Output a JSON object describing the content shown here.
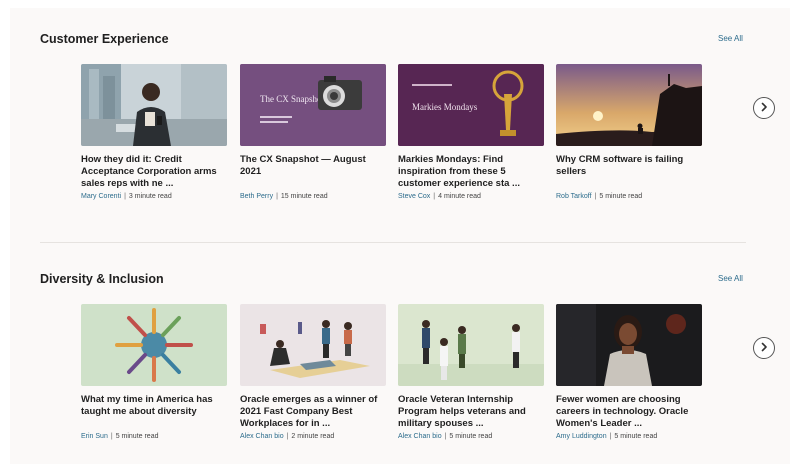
{
  "sections": [
    {
      "title": "Customer Experience",
      "see_all": "See All",
      "cards": [
        {
          "title": "How they did it: Credit Acceptance Corporation arms sales reps with ne ...",
          "author": "Mary Corenti",
          "read": "3 minute read",
          "image": "man-with-phone-city"
        },
        {
          "title": "The CX Snapshot — August 2021",
          "author": "Beth Perry",
          "read": "15 minute read",
          "image": "cx-snapshot-camera"
        },
        {
          "title": "Markies Mondays: Find inspiration from these 5 customer experience sta ...",
          "author": "Steve Cox",
          "read": "4 minute read",
          "image": "markies-trophy"
        },
        {
          "title": "Why CRM software is failing sellers",
          "author": "Rob Tarkoff",
          "read": "5 minute read",
          "image": "sunset-cliff"
        }
      ],
      "thumb_text": {
        "snapshot": "The CX Snapshot",
        "markies": "Markies Mondays"
      }
    },
    {
      "title": "Diversity & Inclusion",
      "see_all": "See All",
      "cards": [
        {
          "title": "What my time in America has taught me about diversity",
          "author": "Erin Sun",
          "read": "5 minute read",
          "image": "pencils-circle-illustration"
        },
        {
          "title": "Oracle emerges as a winner of 2021 Fast Company Best Workplaces for in ...",
          "author": "Alex Chan bio",
          "read": "2 minute read",
          "image": "people-book-illustration"
        },
        {
          "title": "Oracle Veteran Internship Program helps veterans and military spouses ...",
          "author": "Alex Chan bio",
          "read": "5 minute read",
          "image": "veterans-illustration"
        },
        {
          "title": "Fewer women are choosing careers in technology. Oracle Women's Leader ...",
          "author": "Amy Luddington",
          "read": "5 minute read",
          "image": "woman-speaker"
        }
      ]
    }
  ],
  "meta_separator": "|",
  "icons": {
    "next": "chevron-right-icon"
  }
}
